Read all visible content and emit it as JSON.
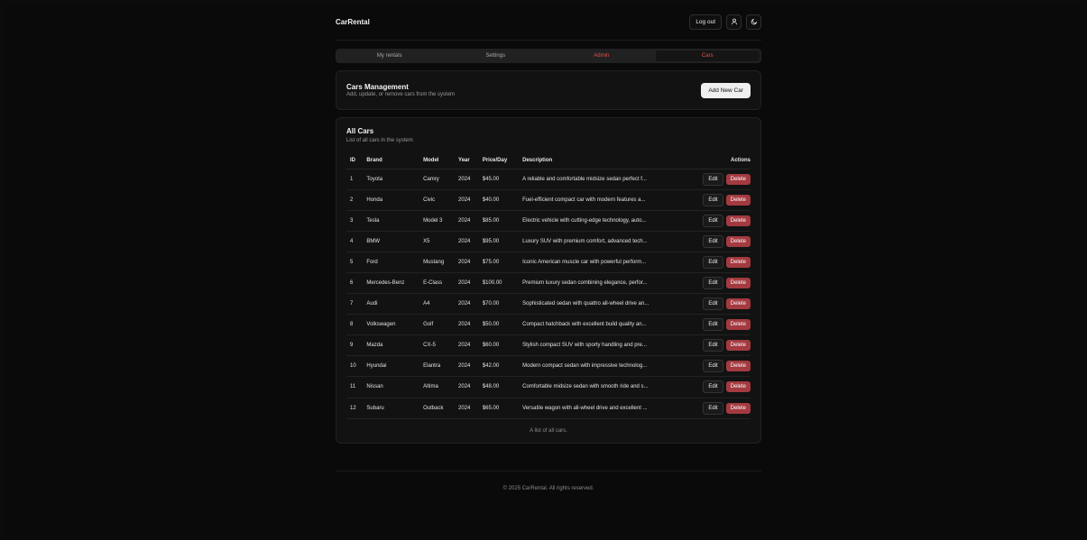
{
  "header": {
    "brand": "CarRental",
    "logout_label": "Log out",
    "user_icon": "user-icon",
    "theme_icon": "theme-toggle-icon"
  },
  "tabs": [
    "My rentals",
    "Settings",
    "Admin",
    "Cars"
  ],
  "management": {
    "title": "Cars Management",
    "subtitle": "Add, update, or remove cars from the system",
    "add_label": "Add New Car"
  },
  "all_cars": {
    "title": "All Cars",
    "subtitle": "List of all cars in the system",
    "columns": [
      "ID",
      "Brand",
      "Model",
      "Year",
      "Price/Day",
      "Description",
      "Actions"
    ],
    "edit_label": "Edit",
    "delete_label": "Delete",
    "rows": [
      {
        "id": "1",
        "brand": "Toyota",
        "model": "Camry",
        "year": "2024",
        "price": "$45.00",
        "desc": "A reliable and comfortable midsize sedan perfect f..."
      },
      {
        "id": "2",
        "brand": "Honda",
        "model": "Civic",
        "year": "2024",
        "price": "$40.00",
        "desc": "Fuel-efficient compact car with modern features a..."
      },
      {
        "id": "3",
        "brand": "Tesla",
        "model": "Model 3",
        "year": "2024",
        "price": "$85.00",
        "desc": "Electric vehicle with cutting-edge technology, auto..."
      },
      {
        "id": "4",
        "brand": "BMW",
        "model": "X5",
        "year": "2024",
        "price": "$95.00",
        "desc": "Luxury SUV with premium comfort, advanced tech..."
      },
      {
        "id": "5",
        "brand": "Ford",
        "model": "Mustang",
        "year": "2024",
        "price": "$75.00",
        "desc": "Iconic American muscle car with powerful perform..."
      },
      {
        "id": "6",
        "brand": "Mercedes-Benz",
        "model": "E-Class",
        "year": "2024",
        "price": "$100.00",
        "desc": "Premium luxury sedan combining elegance, perfor..."
      },
      {
        "id": "7",
        "brand": "Audi",
        "model": "A4",
        "year": "2024",
        "price": "$70.00",
        "desc": "Sophisticated sedan with quattro all-wheel drive an..."
      },
      {
        "id": "8",
        "brand": "Volkswagen",
        "model": "Golf",
        "year": "2024",
        "price": "$50.00",
        "desc": "Compact hatchback with excellent build quality an..."
      },
      {
        "id": "9",
        "brand": "Mazda",
        "model": "CX-5",
        "year": "2024",
        "price": "$60.00",
        "desc": "Stylish compact SUV with sporty handling and pre..."
      },
      {
        "id": "10",
        "brand": "Hyundai",
        "model": "Elantra",
        "year": "2024",
        "price": "$42.00",
        "desc": "Modern compact sedan with impressive technolog..."
      },
      {
        "id": "11",
        "brand": "Nissan",
        "model": "Altima",
        "year": "2024",
        "price": "$48.00",
        "desc": "Comfortable midsize sedan with smooth ride and s..."
      },
      {
        "id": "12",
        "brand": "Subaru",
        "model": "Outback",
        "year": "2024",
        "price": "$65.00",
        "desc": "Versatile wagon with all-wheel drive and excellent ..."
      }
    ],
    "caption": "A list of all cars."
  },
  "footer": "© 2025 CarRental. All rights reserved.",
  "colors": {
    "accent_red": "#ef4b4b",
    "delete_bg": "#a33a3f",
    "background": "#0a0a0a"
  }
}
